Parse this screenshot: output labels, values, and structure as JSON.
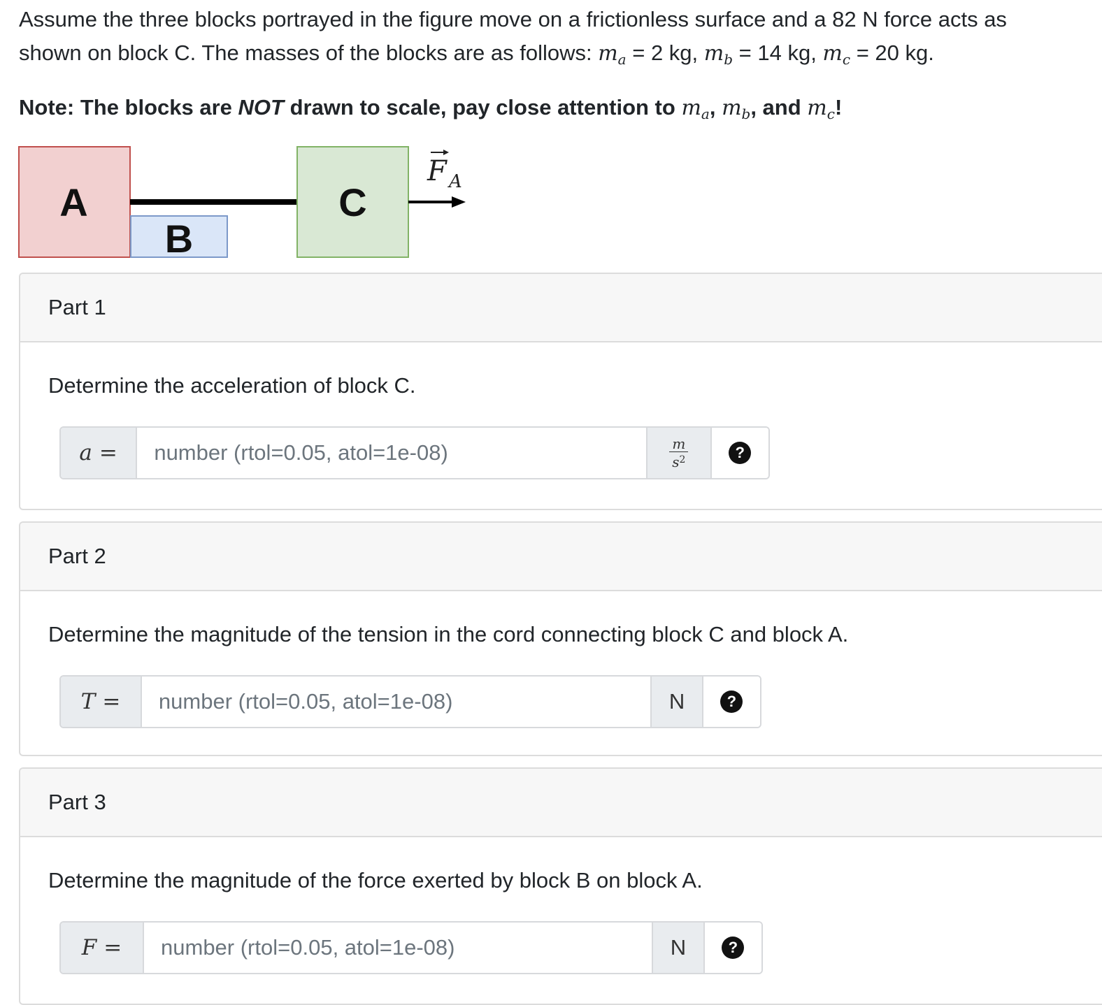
{
  "intro": {
    "line1": "Assume the three blocks portrayed in the figure move on a frictionless surface and a 82 N force acts as",
    "line2_prefix": "shown on block C. The masses of the blocks are as follows: ",
    "ma_symbol": "m",
    "ma_sub": "a",
    "ma_value": " = 2 kg, ",
    "mb_symbol": "m",
    "mb_sub": "b",
    "mb_value": " = 14 kg, ",
    "mc_symbol": "m",
    "mc_sub": "c",
    "mc_value": " = 20 kg."
  },
  "note": {
    "prefix": "Note: The blocks are ",
    "emph": "NOT",
    "middle": " drawn to scale, pay close attention to ",
    "sep1": ", ",
    "sep2": ", and ",
    "suffix": "!"
  },
  "figure": {
    "block_a": "A",
    "block_b": "B",
    "block_c": "C",
    "force_symbol": "F",
    "force_sub": "A",
    "colors": {
      "block_a_fill": "#f2d0d0",
      "block_b_fill": "#dae6f8",
      "block_c_fill": "#d9e8d4"
    }
  },
  "parts": [
    {
      "title": "Part 1",
      "question": "Determine the acceleration of block C.",
      "variable": "a",
      "equals": "=",
      "placeholder": "number (rtol=0.05, atol=1e-08)",
      "unit_num": "m",
      "unit_den": "s",
      "unit_den_exp": "2",
      "help": "?"
    },
    {
      "title": "Part 2",
      "question": "Determine the magnitude of the tension in the cord connecting block C and block A.",
      "variable": "T",
      "equals": "=",
      "placeholder": "number (rtol=0.05, atol=1e-08)",
      "unit": "N",
      "help": "?"
    },
    {
      "title": "Part 3",
      "question": "Determine the magnitude of the force exerted by block B on block A.",
      "variable": "F",
      "equals": "=",
      "placeholder": "number (rtol=0.05, atol=1e-08)",
      "unit": "N",
      "help": "?"
    }
  ]
}
